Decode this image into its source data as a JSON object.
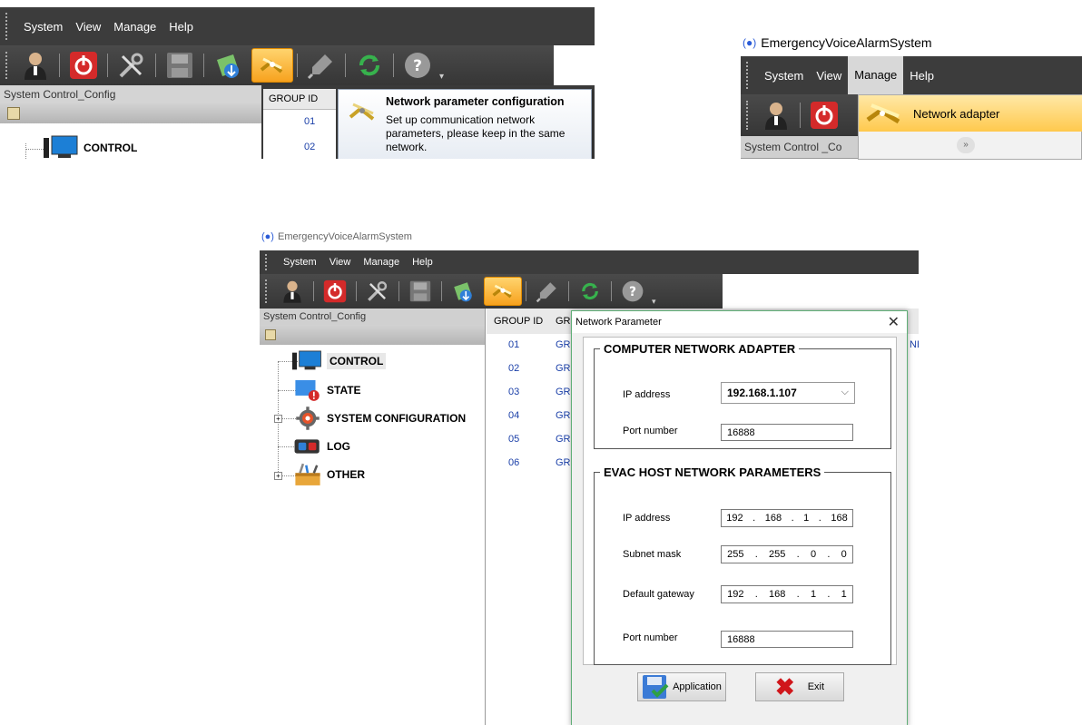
{
  "app": {
    "title": "EmergencyVoiceAlarmSystem"
  },
  "menu": {
    "system": "System",
    "view": "View",
    "manage": "Manage",
    "help": "Help"
  },
  "toolbar_icons": [
    "user-icon",
    "power-icon",
    "tools-icon",
    "save-icon",
    "network-upload-icon",
    "network-config-icon",
    "clear-icon",
    "refresh-icon",
    "help-icon"
  ],
  "panel": {
    "title": "System Control_Config",
    "title_cropped": "System Control _Co"
  },
  "tree": {
    "control": "CONTROL",
    "state": "STATE",
    "system_configuration": "SYSTEM CONFIGURATION",
    "log": "LOG",
    "other": "OTHER"
  },
  "grid": {
    "group_id_header": "GROUP ID",
    "second_header": "GRO",
    "rows": [
      {
        "id": "01",
        "name": "GRO"
      },
      {
        "id": "02",
        "name": "GRO"
      },
      {
        "id": "03",
        "name": "GRO"
      },
      {
        "id": "04",
        "name": "GRO"
      },
      {
        "id": "05",
        "name": "GRO"
      },
      {
        "id": "06",
        "name": "GRO"
      }
    ],
    "edge_text": "NE"
  },
  "tooltip": {
    "title": "Network parameter configuration",
    "body": "Set up communication network parameters, please keep in the same network."
  },
  "manage_dropdown": {
    "item": "Network adapter"
  },
  "dialog": {
    "title": "Network Parameter",
    "computer_group": {
      "legend": "COMPUTER NETWORK ADAPTER",
      "ip_label": "IP address",
      "ip_value": "192.168.1.107",
      "port_label": "Port number",
      "port_value": "16888"
    },
    "host_group": {
      "legend": "EVAC HOST NETWORK PARAMETERS",
      "ip_label": "IP address",
      "ip": [
        "192",
        "168",
        "1",
        "168"
      ],
      "mask_label": "Subnet mask",
      "mask": [
        "255",
        "255",
        "0",
        "0"
      ],
      "gateway_label": "Default gateway",
      "gateway": [
        "192",
        "168",
        "1",
        "1"
      ],
      "port_label": "Port number",
      "port_value": "16888"
    },
    "apply_label": "Application",
    "exit_label": "Exit"
  },
  "colors": {
    "accent_orange": "#f7a21e",
    "dark_bar": "#3c3c3c",
    "link_blue": "#1a3fa8",
    "dialog_border": "#5fae76"
  }
}
